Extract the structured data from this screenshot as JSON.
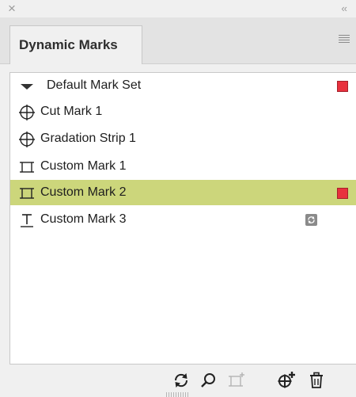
{
  "window": {
    "close_glyph": "×",
    "collapse_glyph": "‹‹"
  },
  "tab": {
    "title": "Dynamic Marks"
  },
  "list": {
    "items": [
      {
        "label": "Default Mark Set",
        "icon": "disclosure-triangle-down-icon",
        "swatch": "#e8313d",
        "selected": false
      },
      {
        "label": "Cut Mark 1",
        "icon": "crosshair-circle-icon",
        "selected": false
      },
      {
        "label": "Gradation Strip 1",
        "icon": "crosshair-circle-icon",
        "selected": false
      },
      {
        "label": "Custom Mark 1",
        "icon": "custom-mark-frame-icon",
        "selected": false
      },
      {
        "label": "Custom Mark 2",
        "icon": "custom-mark-frame-icon",
        "swatch": "#e8313d",
        "selected": true
      },
      {
        "label": "Custom Mark 3",
        "icon": "text-mark-icon",
        "badge": "sync-badge-icon",
        "selected": false
      }
    ],
    "selected_row_color": "#ccd67b"
  },
  "footer": {
    "buttons": [
      {
        "name": "refresh-icon"
      },
      {
        "name": "search-icon"
      },
      {
        "name": "add-custom-mark-icon",
        "disabled": true
      },
      {
        "name": "add-mark-icon"
      },
      {
        "name": "trash-icon"
      }
    ]
  }
}
